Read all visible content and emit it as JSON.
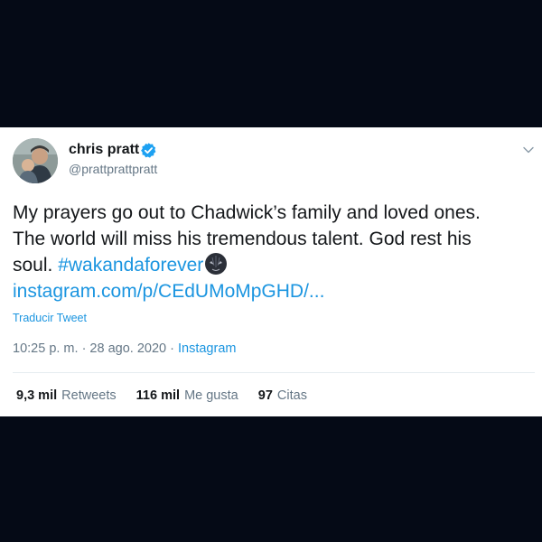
{
  "tweet": {
    "display_name": "chris pratt",
    "handle": "@prattprattpratt",
    "text_line1": "My prayers go out to Chadwick’s family and loved ones.",
    "text_line2": "The world will miss his tremendous talent. God rest his",
    "text_line3_prefix": "soul. ",
    "hashtag": "#wakandaforever",
    "link": "instagram.com/p/CEdUMoMpGHD/...",
    "translate_label": "Traducir Tweet",
    "timestamp": "10:25 p. m. · 28 ago. 2020 · ",
    "source": "Instagram"
  },
  "stats": [
    {
      "count": "9,3 mil",
      "label": "Retweets"
    },
    {
      "count": "116 mil",
      "label": "Me gusta"
    },
    {
      "count": "97",
      "label": "Citas"
    }
  ],
  "icons": {
    "verified": "verified-badge-icon",
    "menu": "chevron-down-icon",
    "emoji": "black-panther-emoji-icon"
  },
  "colors": {
    "background": "#050a16",
    "card": "#ffffff",
    "text": "#14171a",
    "muted": "#657786",
    "link": "#1b95e0",
    "divider": "#e6ecf0"
  }
}
